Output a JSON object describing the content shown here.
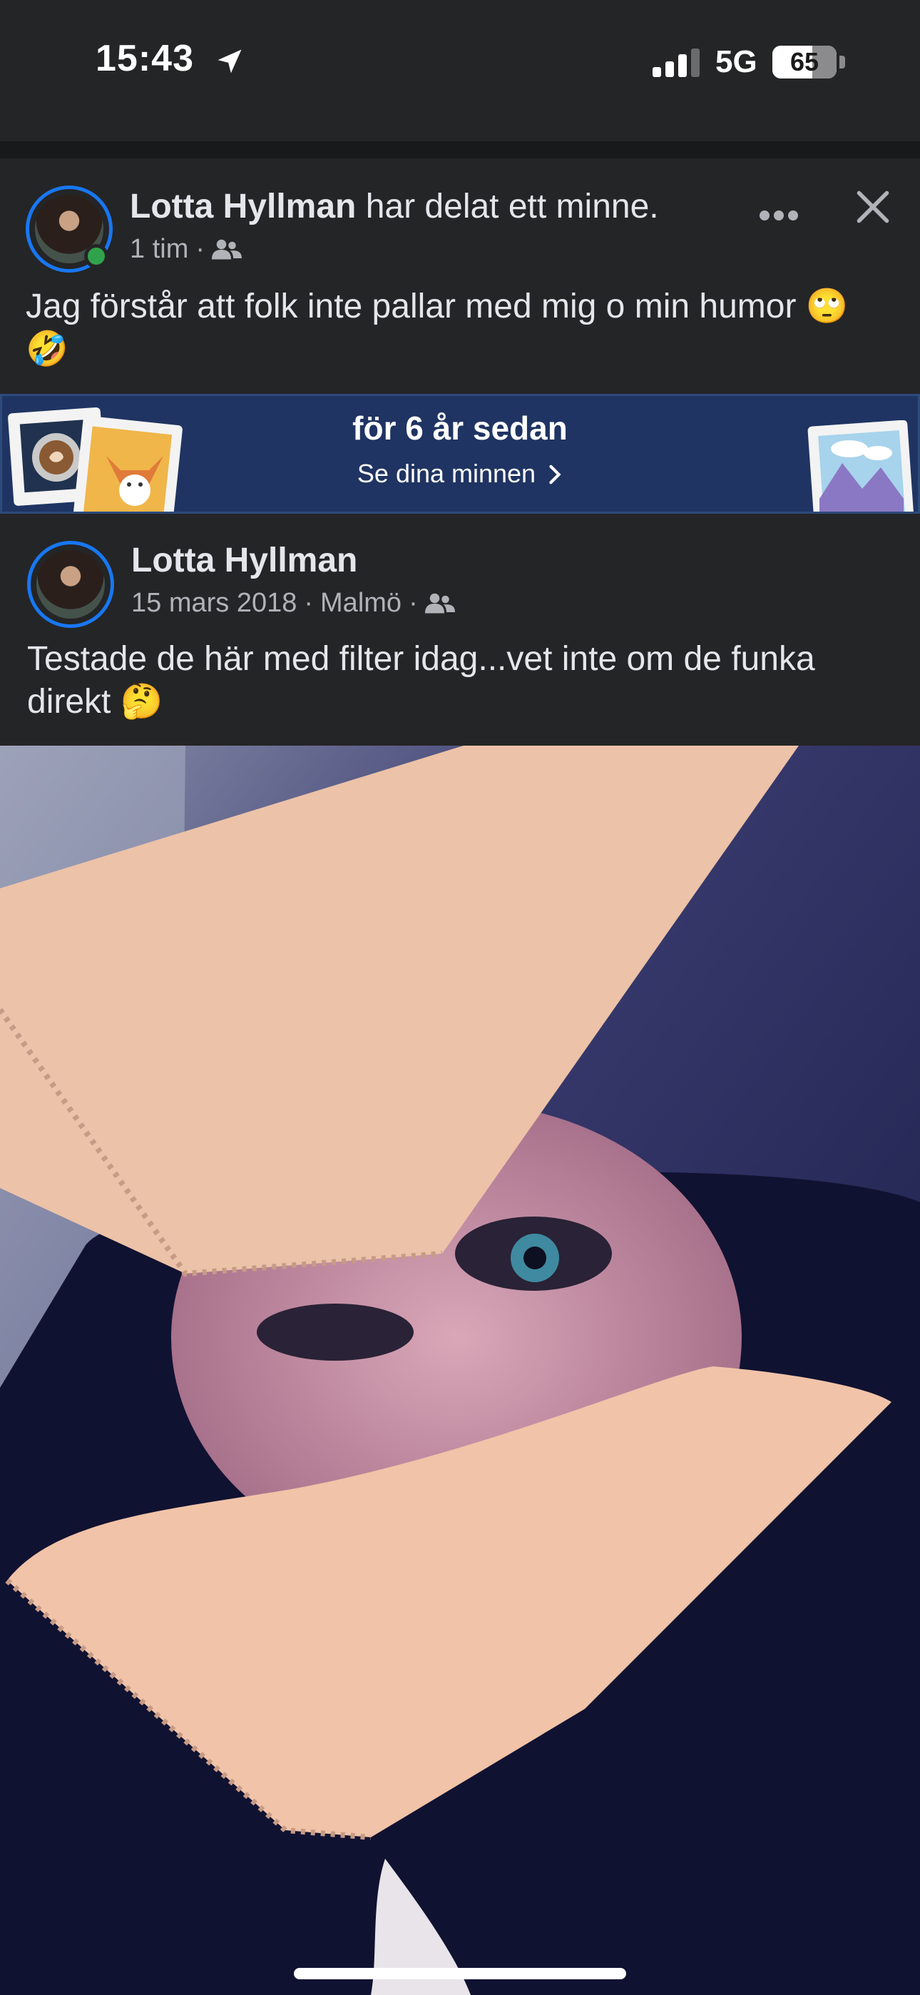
{
  "status_bar": {
    "time": "15:43",
    "network": "5G",
    "battery": "65"
  },
  "post": {
    "author": "Lotta Hyllman",
    "action": " har delat ett minne.",
    "time": "1 tim",
    "separator": "·",
    "text": "Jag förstår att folk inte pallar med mig o min humor 🙄🤣"
  },
  "memory_banner": {
    "title": "för 6 år sedan",
    "link": "Se dina minnen"
  },
  "shared_post": {
    "author": "Lotta Hyllman",
    "date": "15 mars 2018",
    "separator1": "·",
    "location": "Malmö",
    "separator2": "·",
    "text": "Testade de här med filter idag...vet inte om de funka direkt 🤔"
  },
  "colors": {
    "background": "#242526",
    "accent": "#1877f2",
    "online": "#31a24c",
    "banner": "#1f3462"
  },
  "icons": [
    "location-arrow-icon",
    "signal-icon",
    "battery-icon",
    "friends-icon",
    "more-icon",
    "close-icon",
    "chevron-right-icon"
  ]
}
